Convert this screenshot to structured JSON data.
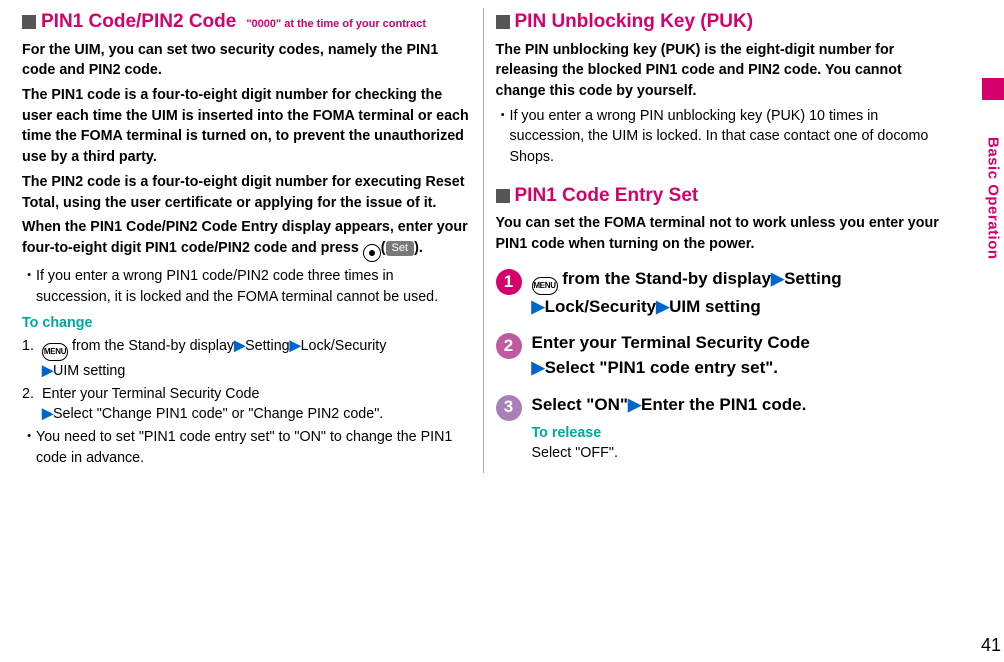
{
  "sidebar": {
    "label": "Basic Operation",
    "page_number": "41"
  },
  "left": {
    "sec_title": "PIN1 Code/PIN2 Code",
    "sec_sub": "\"0000\" at the time of your contract",
    "p1": "For the UIM, you can set two security codes, namely the PIN1 code and PIN2 code.",
    "p2": "The PIN1 code is a four-to-eight digit number for checking the user each time the UIM is inserted into the FOMA terminal or each time the FOMA terminal is turned on, to prevent the unauthorized use by a third party.",
    "p3": "The PIN2 code is a four-to-eight digit number for executing Reset Total, using the user certificate or applying for the issue of it.",
    "p4a": "When the PIN1 Code/PIN2 Code Entry display appears, enter your four-to-eight digit PIN1 code/PIN2 code and press ",
    "p4b": "(",
    "set_label": "Set",
    "p4c": ").",
    "bullet1": "If you enter a wrong PIN1 code/PIN2 code three times in succession, it is locked and the FOMA terminal cannot be used.",
    "to_change": "To change",
    "menu_label": "MENU",
    "step1_a": " from the Stand-by display",
    "step1_b": "Setting",
    "step1_c": "Lock/Security",
    "step1_d": "UIM setting",
    "step2_a": "Enter your Terminal Security Code",
    "step2_b": "Select \"Change PIN1 code\" or \"Change PIN2 code\".",
    "bullet2": "You need to set \"PIN1 code entry set\" to \"ON\" to change the PIN1 code in advance."
  },
  "right": {
    "puk_title": "PIN Unblocking Key (PUK)",
    "puk_p1": "The PIN unblocking key (PUK) is the eight-digit number for releasing the blocked PIN1 code and PIN2 code. You cannot change this code by yourself.",
    "puk_bullet": "If you enter a wrong PIN unblocking key (PUK) 10 times in succession, the UIM is locked. In that case contact one of docomo Shops.",
    "entry_title": "PIN1 Code Entry Set",
    "entry_p1": "You can set the FOMA terminal not to work unless you enter your PIN1 code when turning on the power.",
    "menu_label": "MENU",
    "s1_a": " from the Stand-by display",
    "s1_b": "Setting",
    "s1_c": "Lock/Security",
    "s1_d": "UIM setting",
    "s2_a": "Enter your Terminal Security Code",
    "s2_b": "Select \"PIN1 code entry set\".",
    "s3_a": "Select \"ON\"",
    "s3_b": "Enter the PIN1 code.",
    "to_release": "To release",
    "release_text": "Select \"OFF\"."
  }
}
